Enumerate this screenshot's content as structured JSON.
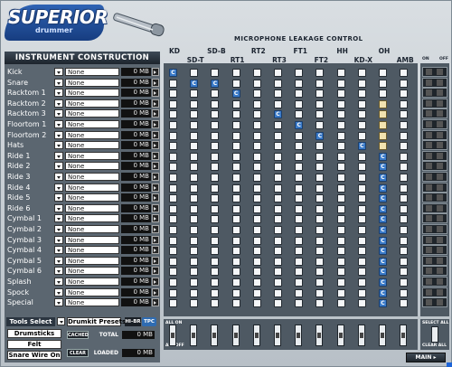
{
  "brand": {
    "name": "SUPERIOR",
    "sub": "drummer"
  },
  "left_panel": {
    "title": "INSTRUMENT CONSTRUCTION",
    "instruments": [
      {
        "name": "Kick",
        "value": "None",
        "mb": "0 MB"
      },
      {
        "name": "Snare",
        "value": "None",
        "mb": "0 MB"
      },
      {
        "name": "Racktom 1",
        "value": "None",
        "mb": "0 MB"
      },
      {
        "name": "Racktom 2",
        "value": "None",
        "mb": "0 MB"
      },
      {
        "name": "Racktom 3",
        "value": "None",
        "mb": "0 MB"
      },
      {
        "name": "Floortom 1",
        "value": "None",
        "mb": "0 MB"
      },
      {
        "name": "Floortom 2",
        "value": "None",
        "mb": "0 MB"
      },
      {
        "name": "Hats",
        "value": "None",
        "mb": "0 MB"
      },
      {
        "name": "Ride 1",
        "value": "None",
        "mb": "0 MB"
      },
      {
        "name": "Ride 2",
        "value": "None",
        "mb": "0 MB"
      },
      {
        "name": "Ride 3",
        "value": "None",
        "mb": "0 MB"
      },
      {
        "name": "Ride 4",
        "value": "None",
        "mb": "0 MB"
      },
      {
        "name": "Ride 5",
        "value": "None",
        "mb": "0 MB"
      },
      {
        "name": "Ride 6",
        "value": "None",
        "mb": "0 MB"
      },
      {
        "name": "Cymbal 1",
        "value": "None",
        "mb": "0 MB"
      },
      {
        "name": "Cymbal 2",
        "value": "None",
        "mb": "0 MB"
      },
      {
        "name": "Cymbal 3",
        "value": "None",
        "mb": "0 MB"
      },
      {
        "name": "Cymbal 4",
        "value": "None",
        "mb": "0 MB"
      },
      {
        "name": "Cymbal 5",
        "value": "None",
        "mb": "0 MB"
      },
      {
        "name": "Cymbal 6",
        "value": "None",
        "mb": "0 MB"
      },
      {
        "name": "Splash",
        "value": "None",
        "mb": "0 MB"
      },
      {
        "name": "Spock",
        "value": "None",
        "mb": "0 MB"
      },
      {
        "name": "Special",
        "value": "None",
        "mb": "0 MB"
      }
    ]
  },
  "tools": {
    "title": "Tools Select",
    "preset": "Drumkit Presets",
    "hibr": "HI-BR",
    "tpc": "TPC",
    "buttons": [
      "Drumsticks",
      "Felt",
      "Snare Wire On"
    ],
    "cached_label": "CACHED",
    "clear_label": "CLEAR",
    "total_label": "TOTAL",
    "total_value": "0 MB",
    "loaded_label": "LOADED",
    "loaded_value": "0 MB"
  },
  "grid": {
    "title": "MICROPHONE LEAKAGE CONTROL",
    "top_labels": [
      "KD",
      "SD-B",
      "RT2",
      "FT1",
      "HH",
      "OH"
    ],
    "bottom_labels": [
      "SD-T",
      "RT1",
      "RT3",
      "FT2",
      "KD-X",
      "AMB"
    ],
    "all_on": "ALL ON",
    "all_off": "ALL OFF",
    "on_letter": "C",
    "right_on": "ON",
    "right_off": "OFF",
    "select_all": "SELECT ALL",
    "clear_all": "CLEAR ALL",
    "main": "MAIN ▸"
  }
}
